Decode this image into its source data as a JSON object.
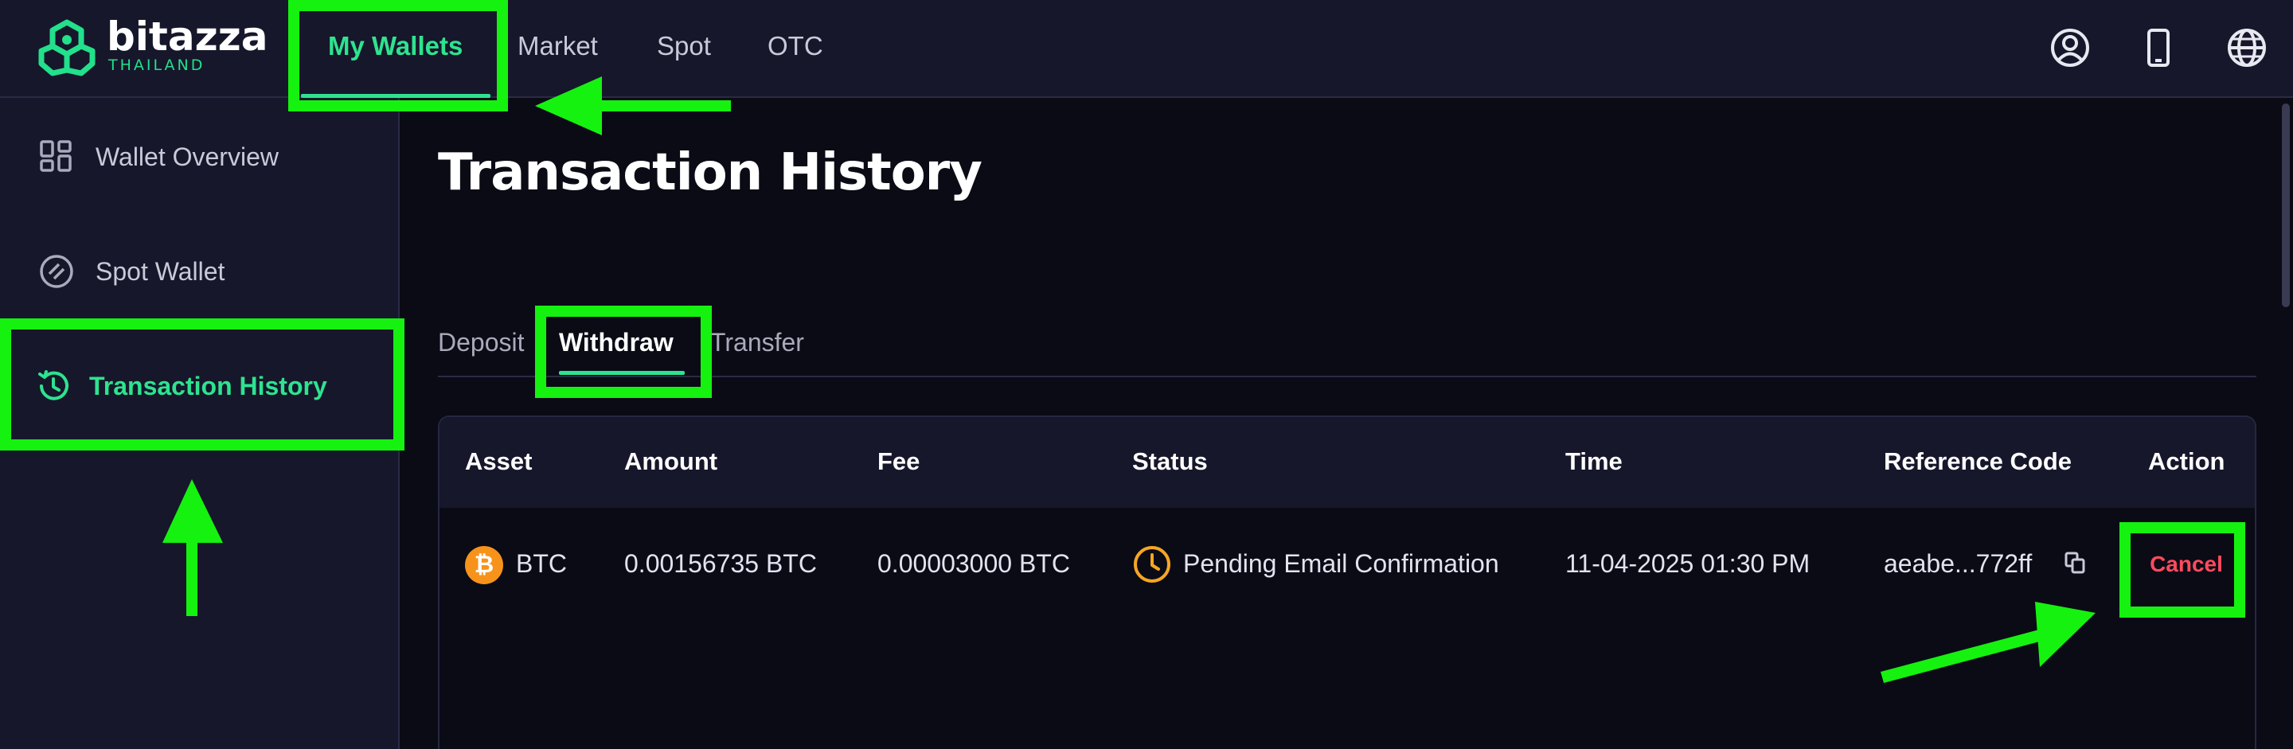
{
  "brand": {
    "name": "bitazza",
    "region": "THAILAND"
  },
  "nav": {
    "items": [
      {
        "label": "My Wallets",
        "active": true
      },
      {
        "label": "Market",
        "active": false
      },
      {
        "label": "Spot",
        "active": false
      },
      {
        "label": "OTC",
        "active": false
      }
    ],
    "right_icons": [
      "user-icon",
      "mobile-icon",
      "globe-icon"
    ]
  },
  "sidebar": {
    "items": [
      {
        "label": "Wallet Overview",
        "icon": "grid-icon",
        "active": false
      },
      {
        "label": "Spot Wallet",
        "icon": "spot-wallet-icon",
        "active": false
      },
      {
        "label": "Transaction History",
        "icon": "history-icon",
        "active": true
      }
    ]
  },
  "page": {
    "title": "Transaction History"
  },
  "tabs": [
    {
      "label": "Deposit",
      "active": false
    },
    {
      "label": "Withdraw",
      "active": true
    },
    {
      "label": "Transfer",
      "active": false
    }
  ],
  "table": {
    "columns": [
      "Asset",
      "Amount",
      "Fee",
      "Status",
      "Time",
      "Reference Code",
      "Action"
    ],
    "rows": [
      {
        "asset": "BTC",
        "coin_icon": "bitcoin-icon",
        "amount": "0.00156735 BTC",
        "fee": "0.00003000 BTC",
        "status": "Pending Email Confirmation",
        "status_icon": "clock-icon",
        "time": "11-04-2025 01:30 PM",
        "reference": "aeabe...772ff",
        "action": "Cancel"
      }
    ]
  },
  "colors": {
    "accent": "#2ee38f",
    "background": "#0b0b16",
    "panel": "#16172b",
    "annotation": "#15f20f",
    "danger": "#ff4b5c",
    "pending": "#f5a623",
    "bitcoin": "#f7931a"
  }
}
